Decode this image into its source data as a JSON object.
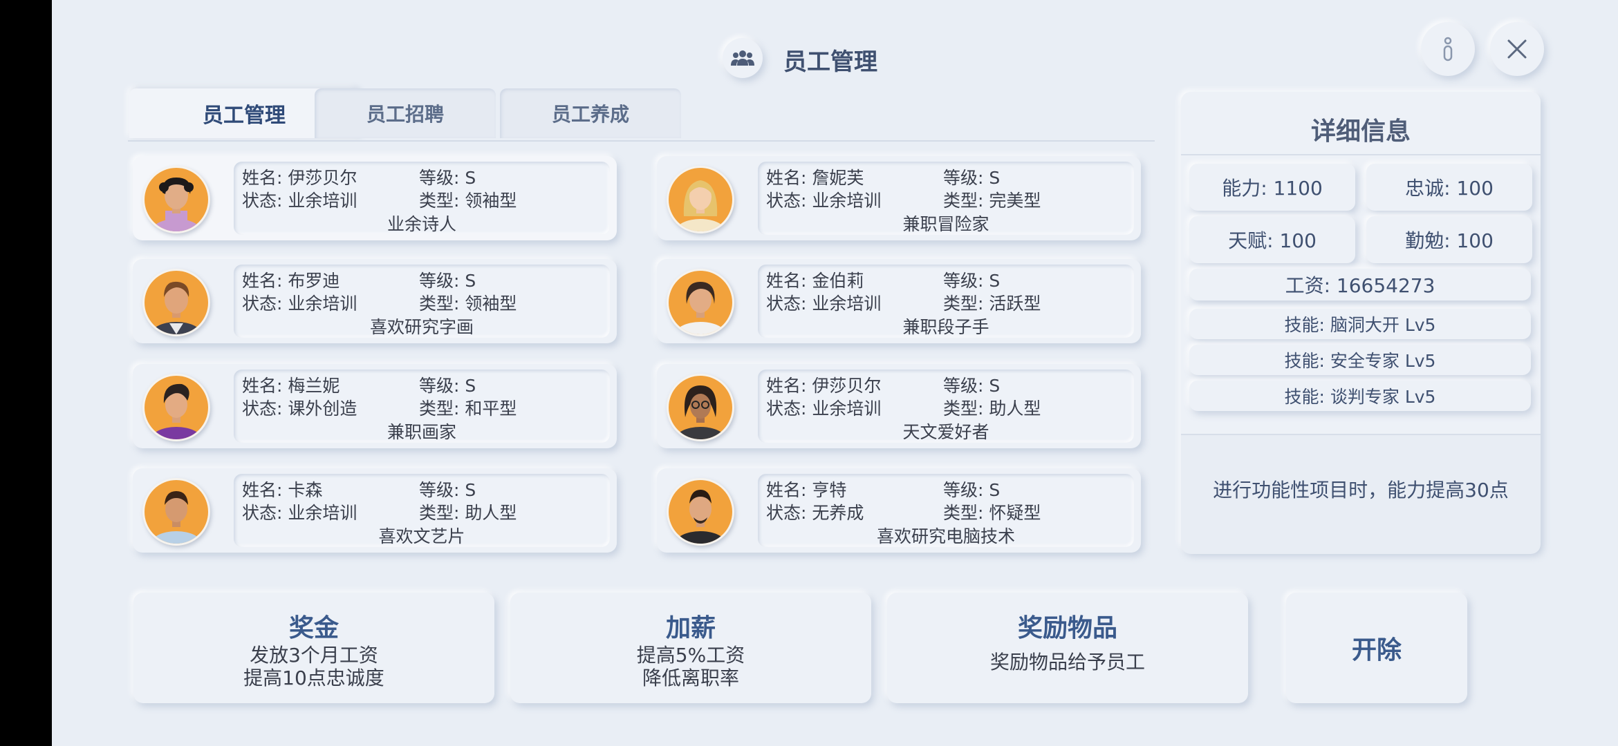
{
  "header": {
    "title": "员工管理",
    "icon": "people-icon",
    "info_icon": "info-icon",
    "close_icon": "close-icon"
  },
  "tabs": [
    {
      "label": "员工管理",
      "active": true
    },
    {
      "label": "员工招聘",
      "active": false
    },
    {
      "label": "员工养成",
      "active": false
    }
  ],
  "employees": [
    {
      "name": "姓名: 伊莎贝尔",
      "level": "等级: S",
      "status": "状态: 业余培训",
      "type": "类型: 领袖型",
      "hobby": "业余诗人",
      "selected": true
    },
    {
      "name": "姓名: 詹妮芙",
      "level": "等级: S",
      "status": "状态: 业余培训",
      "type": "类型: 完美型",
      "hobby": "兼职冒险家"
    },
    {
      "name": "姓名: 布罗迪",
      "level": "等级: S",
      "status": "状态: 业余培训",
      "type": "类型: 领袖型",
      "hobby": "喜欢研究字画"
    },
    {
      "name": "姓名: 金伯莉",
      "level": "等级: S",
      "status": "状态: 业余培训",
      "type": "类型: 活跃型",
      "hobby": "兼职段子手"
    },
    {
      "name": "姓名: 梅兰妮",
      "level": "等级: S",
      "status": "状态: 课外创造",
      "type": "类型: 和平型",
      "hobby": "兼职画家"
    },
    {
      "name": "姓名: 伊莎贝尔",
      "level": "等级: S",
      "status": "状态: 业余培训",
      "type": "类型: 助人型",
      "hobby": "天文爱好者"
    },
    {
      "name": "姓名: 卡森",
      "level": "等级: S",
      "status": "状态: 业余培训",
      "type": "类型: 助人型",
      "hobby": "喜欢文艺片"
    },
    {
      "name": "姓名: 亨特",
      "level": "等级: S",
      "status": "状态: 无养成",
      "type": "类型: 怀疑型",
      "hobby": "喜欢研究电脑技术"
    }
  ],
  "detail": {
    "title": "详细信息",
    "ability": "能力: 1100",
    "loyalty": "忠诚: 100",
    "talent": "天赋: 100",
    "diligence": "勤勉: 100",
    "salary": "工资: 16654273",
    "skills": [
      "技能: 脑洞大开  Lv5",
      "技能: 安全专家  Lv5",
      "技能: 谈判专家  Lv5"
    ],
    "description": "进行功能性项目时，能力提高30点"
  },
  "actions": {
    "bonus": {
      "title": "奖金",
      "line1": "发放3个月工资",
      "line2": "提高10点忠诚度"
    },
    "raise": {
      "title": "加薪",
      "line1": "提高5%工资",
      "line2": "降低离职率"
    },
    "reward": {
      "title": "奖励物品",
      "line1": "奖励物品给予员工"
    },
    "fire": {
      "title": "开除"
    }
  },
  "colors": {
    "background": "#e9eef5",
    "accent": "#3a5a8c",
    "avatar_bg": "#f2a23c"
  }
}
